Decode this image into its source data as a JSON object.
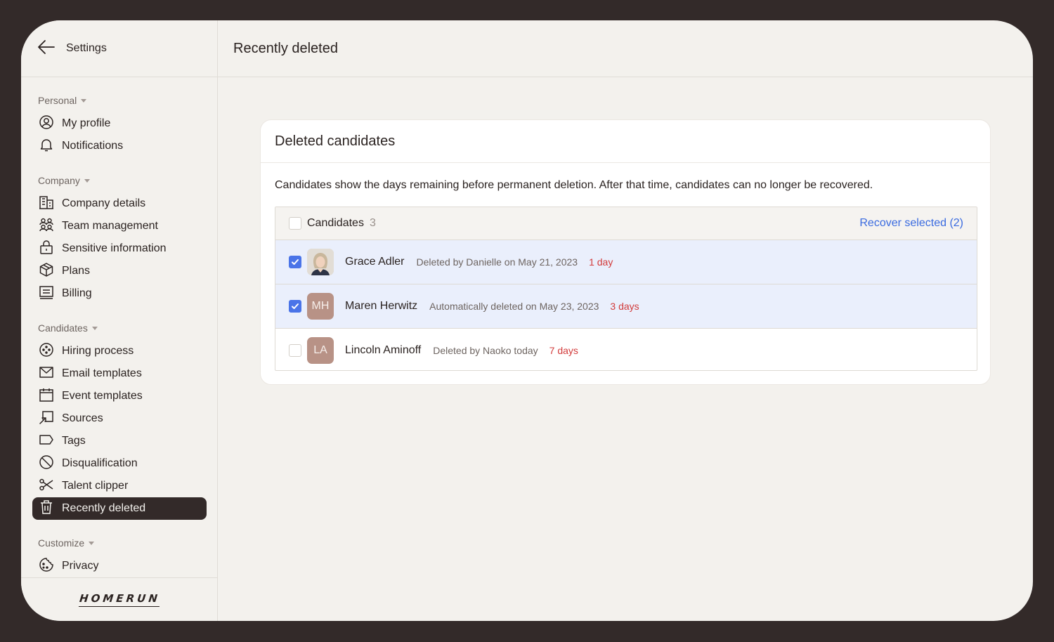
{
  "sidebar": {
    "back_label": "Settings",
    "sections": {
      "personal": "Personal",
      "company": "Company",
      "candidates": "Candidates",
      "customize": "Customize"
    },
    "items": {
      "my_profile": "My profile",
      "notifications": "Notifications",
      "company_details": "Company details",
      "team_management": "Team management",
      "sensitive_information": "Sensitive information",
      "plans": "Plans",
      "billing": "Billing",
      "hiring_process": "Hiring process",
      "email_templates": "Email templates",
      "event_templates": "Event templates",
      "sources": "Sources",
      "tags": "Tags",
      "disqualification": "Disqualification",
      "talent_clipper": "Talent clipper",
      "recently_deleted": "Recently deleted",
      "privacy": "Privacy"
    },
    "active_item": "recently_deleted",
    "logo": "HOMERUN"
  },
  "header": {
    "title": "Recently deleted"
  },
  "card": {
    "title": "Deleted candidates",
    "description": "Candidates show the days remaining before permanent deletion. After that time, candidates can no longer be recovered.",
    "table": {
      "header_label": "Candidates",
      "count": "3",
      "recover_label": "Recover selected (2)",
      "rows": [
        {
          "name": "Grace Adler",
          "initials": "",
          "meta": "Deleted by Danielle on May 21, 2023",
          "days": "1 day",
          "checked": true
        },
        {
          "name": "Maren Herwitz",
          "initials": "MH",
          "meta": "Automatically deleted on May 23, 2023",
          "days": "3 days",
          "checked": true
        },
        {
          "name": "Lincoln Aminoff",
          "initials": "LA",
          "meta": "Deleted by Naoko today",
          "days": "7 days",
          "checked": false
        }
      ]
    }
  },
  "colors": {
    "frame": "#332a29",
    "background": "#f3f1ed",
    "accent": "#4a74e8",
    "link": "#3a6be0",
    "danger": "#d23b3b",
    "avatar": "#b89286"
  }
}
